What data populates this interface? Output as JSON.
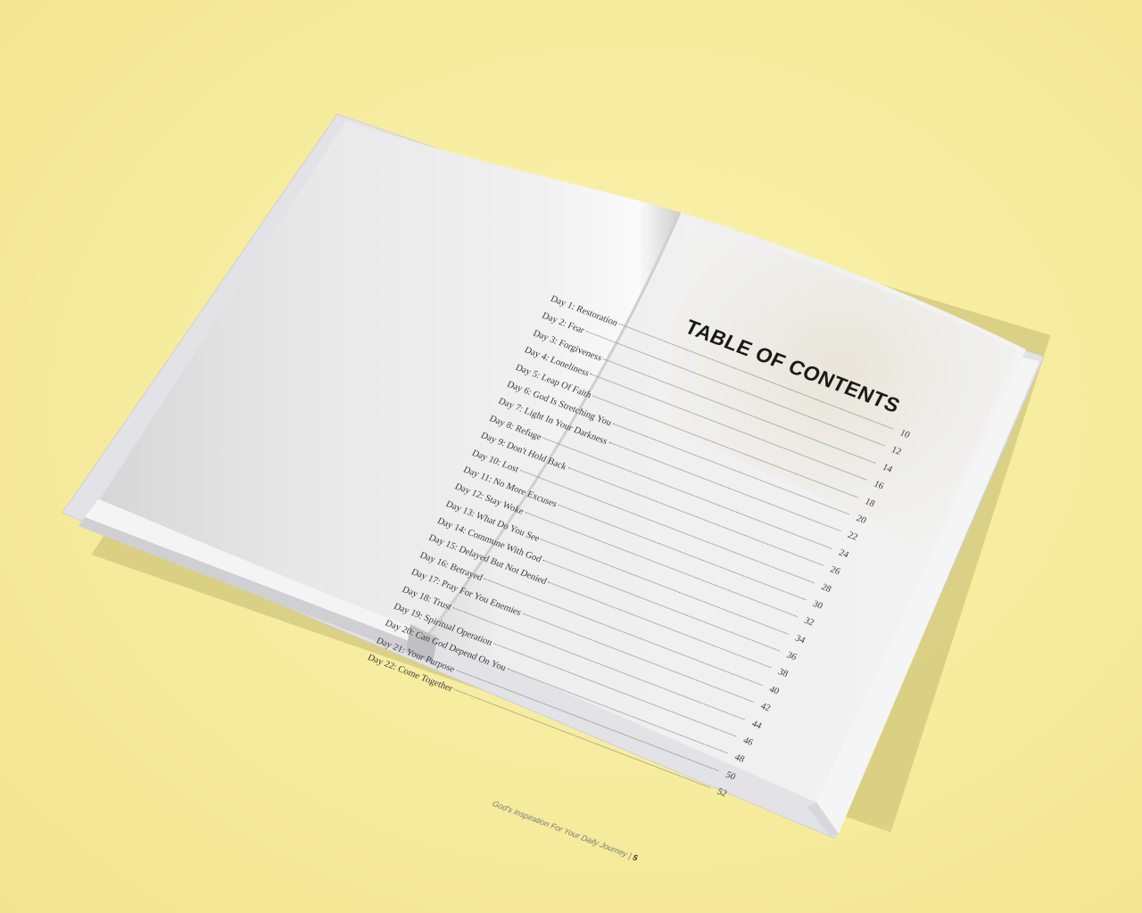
{
  "book": {
    "toc_title": "TABLE OF CONTENTS",
    "entries": [
      {
        "label": "Day 1: Restoration",
        "page": "10"
      },
      {
        "label": "Day 2: Fear",
        "page": "12"
      },
      {
        "label": "Day 3: Forgiveness",
        "page": "14"
      },
      {
        "label": "Day 4: Loneliness",
        "page": "16"
      },
      {
        "label": "Day 5: Leap Of Faith",
        "page": "18"
      },
      {
        "label": "Day 6: God Is Stretching You",
        "page": "20"
      },
      {
        "label": "Day 7: Light In Your Darkness",
        "page": "22"
      },
      {
        "label": "Day 8: Refuge",
        "page": "24"
      },
      {
        "label": "Day 9: Don't Hold Back",
        "page": "26"
      },
      {
        "label": "Day 10: Lost",
        "page": "28"
      },
      {
        "label": "Day 11: No More Excuses",
        "page": "30"
      },
      {
        "label": "Day 12: Stay Woke",
        "page": "32"
      },
      {
        "label": "Day 13: What Do You See",
        "page": "34"
      },
      {
        "label": "Day 14: Commune With God",
        "page": "36"
      },
      {
        "label": "Day 15: Delayed But Not Denied",
        "page": "38"
      },
      {
        "label": "Day 16: Betrayed",
        "page": "40"
      },
      {
        "label": "Day 17: Pray For You Enemies",
        "page": "42"
      },
      {
        "label": "Day 18: Trust",
        "page": "44"
      },
      {
        "label": "Day 19: Spiritual Operation",
        "page": "46"
      },
      {
        "label": "Day 20: Can God Depend On You",
        "page": "48"
      },
      {
        "label": "Day 21: Your Purpose",
        "page": "50"
      },
      {
        "label": "Day 22: Come Together",
        "page": "52"
      }
    ],
    "footer_text": "God's Inspiration For Your Daily Journey",
    "footer_separator": "|",
    "page_number": "5"
  },
  "colors": {
    "background": "#f7ee9f",
    "cover": "#e4e4e8",
    "page_left": "#ececec",
    "page_right": "#f1f1f1",
    "title_text": "#1a1a1a"
  }
}
